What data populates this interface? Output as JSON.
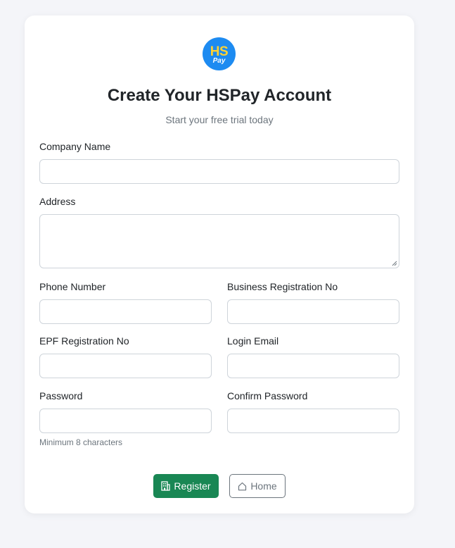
{
  "header": {
    "logo_top": "HS",
    "logo_bottom": "Pay",
    "title": "Create Your HSPay Account",
    "subtitle": "Start your free trial today"
  },
  "form": {
    "company_name": {
      "label": "Company Name",
      "value": ""
    },
    "address": {
      "label": "Address",
      "value": ""
    },
    "phone": {
      "label": "Phone Number",
      "value": ""
    },
    "business_reg": {
      "label": "Business Registration No",
      "value": ""
    },
    "epf_reg": {
      "label": "EPF Registration No",
      "value": ""
    },
    "login_email": {
      "label": "Login Email",
      "value": ""
    },
    "password": {
      "label": "Password",
      "value": "",
      "hint": "Minimum 8 characters"
    },
    "confirm_password": {
      "label": "Confirm Password",
      "value": ""
    }
  },
  "actions": {
    "register_label": "Register",
    "register_icon": "building-icon",
    "home_label": "Home",
    "home_icon": "house-icon"
  },
  "colors": {
    "logo_bg": "#1d8bf1",
    "logo_text": "#ffd233",
    "register_bg": "#198754",
    "home_border": "#6c757d"
  }
}
